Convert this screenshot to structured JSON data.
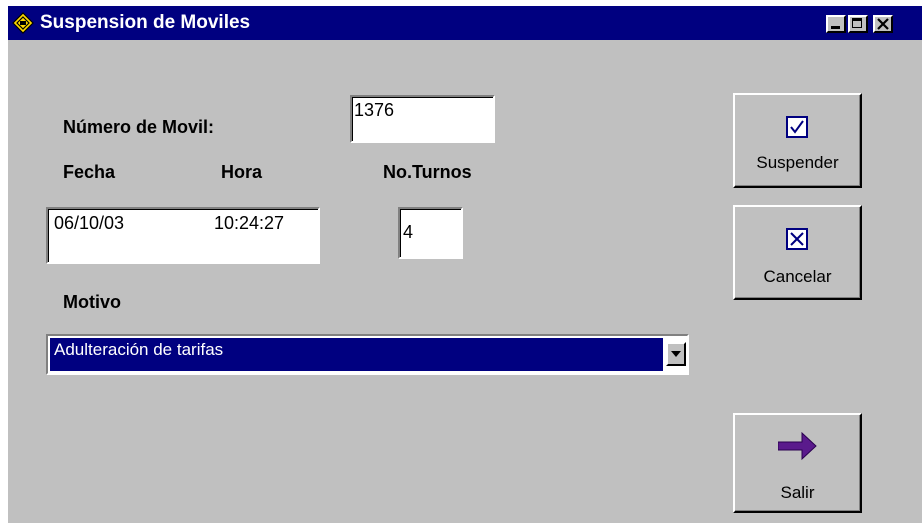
{
  "window": {
    "title": "Suspension de Moviles",
    "title_icon": "app-diamond-icon",
    "controls": [
      "minimize-icon",
      "maximize-icon",
      "close-icon"
    ]
  },
  "form": {
    "movil_label": "Número de Movil:",
    "movil_value": "1376",
    "fecha_label": "Fecha",
    "hora_label": "Hora",
    "turnos_label": "No.Turnos",
    "fecha_value": "06/10/03",
    "hora_value": "10:24:27",
    "turnos_value": "4",
    "motivo_label": "Motivo",
    "motivo_selected": "Adulteración de tarifas"
  },
  "buttons": {
    "suspender": {
      "label": "Suspender",
      "icon": "checkbox-check-icon"
    },
    "cancelar": {
      "label": "Cancelar",
      "icon": "checkbox-x-icon"
    },
    "salir": {
      "label": "Salir",
      "icon": "arrow-right-icon"
    }
  },
  "colors": {
    "titlebar": "#000080",
    "face": "#c0c0c0",
    "arrow": "#5a1a8c"
  }
}
